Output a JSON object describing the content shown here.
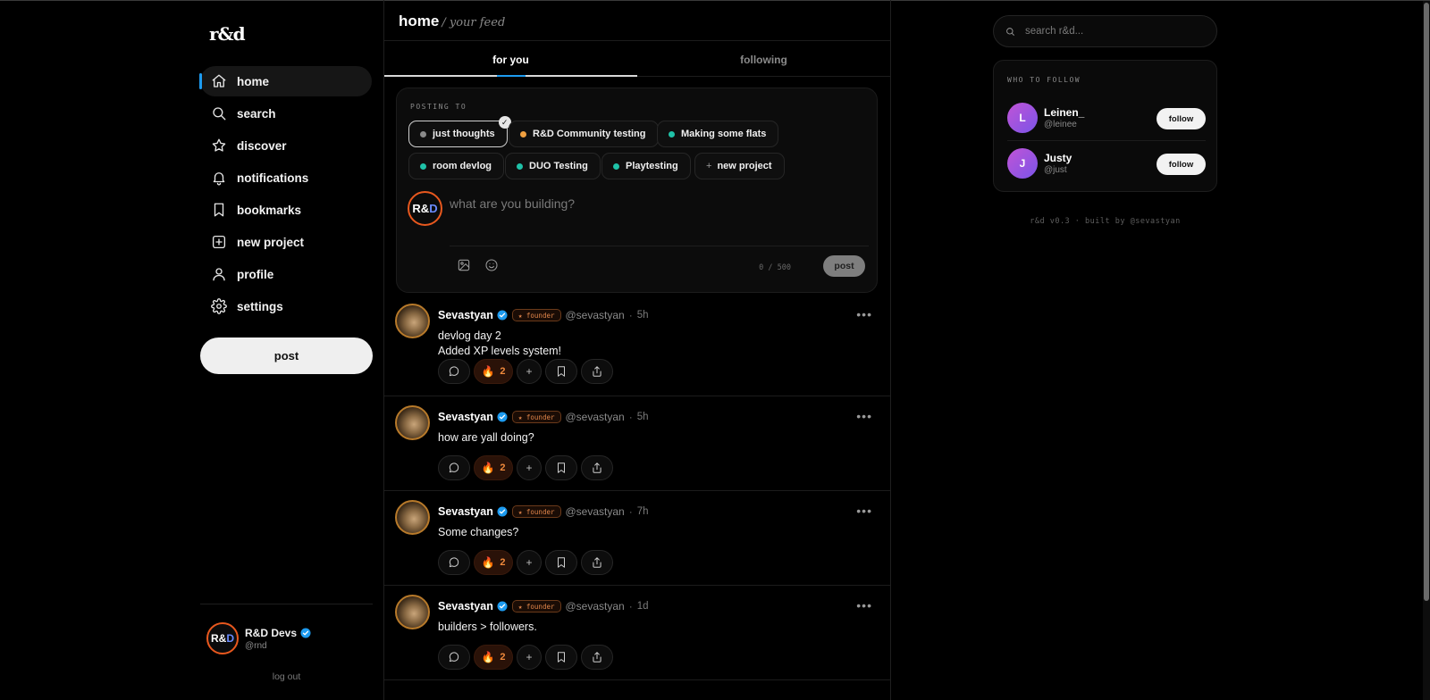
{
  "app": {
    "logo": "r&d"
  },
  "nav": {
    "items": [
      {
        "label": "home",
        "icon": "home-icon",
        "active": true
      },
      {
        "label": "search",
        "icon": "search-icon"
      },
      {
        "label": "discover",
        "icon": "star-icon"
      },
      {
        "label": "notifications",
        "icon": "bell-icon"
      },
      {
        "label": "bookmarks",
        "icon": "bookmark-icon"
      },
      {
        "label": "new project",
        "icon": "plus-square-icon"
      },
      {
        "label": "profile",
        "icon": "user-icon"
      },
      {
        "label": "settings",
        "icon": "gear-icon"
      }
    ],
    "post_label": "post"
  },
  "account": {
    "avatar_text_1": "R&",
    "avatar_text_2": "D",
    "name": "R&D Devs",
    "handle": "@rnd",
    "logout_label": "log out"
  },
  "header": {
    "title": "home",
    "subtitle": "/ your feed"
  },
  "tabs": [
    {
      "label": "for you",
      "active": true
    },
    {
      "label": "following"
    }
  ],
  "composer": {
    "posting_to_label": "POSTING TO",
    "chips": [
      {
        "label": "just thoughts",
        "dot": "#8a8a8a",
        "selected": true
      },
      {
        "label": "R&D Community testing",
        "dot": "#f0a040"
      },
      {
        "label": "Making some flats",
        "dot": "#1fc2a8"
      },
      {
        "label": "room devlog",
        "dot": "#1fc2a8"
      },
      {
        "label": "DUO Testing",
        "dot": "#1fc2a8"
      },
      {
        "label": "Playtesting",
        "dot": "#1fc2a8"
      },
      {
        "label": "new project",
        "plus": "+"
      }
    ],
    "placeholder": "what are you building?",
    "counter": "0 / 500",
    "post_label": "post",
    "check": "✓"
  },
  "posts": [
    {
      "name": "Sevastyan",
      "badge": "★ founder",
      "handle": "@sevastyan",
      "sep": "·",
      "time": "5h",
      "lines": [
        "devlog day 2",
        "Added XP levels system!"
      ],
      "fire_count": "2"
    },
    {
      "name": "Sevastyan",
      "badge": "★ founder",
      "handle": "@sevastyan",
      "sep": "·",
      "time": "5h",
      "lines": [
        "how are yall doing?"
      ],
      "fire_count": "2"
    },
    {
      "name": "Sevastyan",
      "badge": "★ founder",
      "handle": "@sevastyan",
      "sep": "·",
      "time": "7h",
      "lines": [
        "Some changes?"
      ],
      "fire_count": "2"
    },
    {
      "name": "Sevastyan",
      "badge": "★ founder",
      "handle": "@sevastyan",
      "sep": "·",
      "time": "1d",
      "lines": [
        "builders > followers."
      ],
      "fire_count": "2"
    }
  ],
  "post_actions": {
    "more": "•••",
    "add": "+",
    "flame": "🔥"
  },
  "right": {
    "search_placeholder": "search r&d...",
    "who_to_follow_title": "WHO TO FOLLOW",
    "suggestions": [
      {
        "initial": "L",
        "name": "Leinen_",
        "handle": "@leinee",
        "follow_label": "follow"
      },
      {
        "initial": "J",
        "name": "Justy",
        "handle": "@just",
        "follow_label": "follow"
      }
    ],
    "footer": "r&d v0.3 · built by @sevastyan"
  },
  "colors": {
    "accent": "#1d9bf0",
    "founder_badge": "#e0854a",
    "fire": "#f08a3c",
    "avatar_ring": "#e8581e"
  }
}
